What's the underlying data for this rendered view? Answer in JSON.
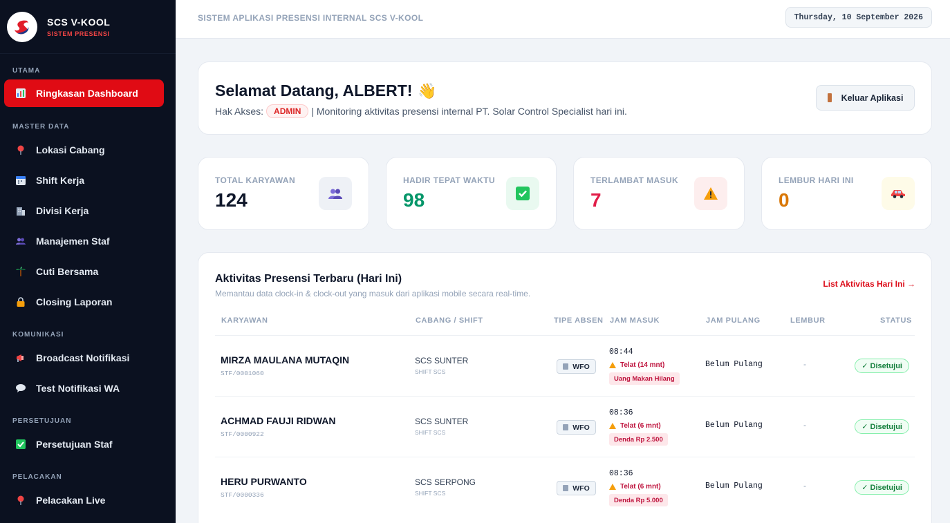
{
  "app": {
    "name": "SCS V-KOOL",
    "subtitle": "SISTEM PRESENSI"
  },
  "sidebar": {
    "sections": {
      "utama": "UTAMA",
      "master": "MASTER DATA",
      "komunikasi": "KOMUNIKASI",
      "persetujuan": "PERSETUJUAN",
      "pelacakan": "PELACAKAN"
    },
    "items": [
      {
        "label": "Ringkasan Dashboard",
        "icon": "chart-icon"
      },
      {
        "label": "Lokasi Cabang",
        "icon": "pin-icon"
      },
      {
        "label": "Shift Kerja",
        "icon": "calendar-icon"
      },
      {
        "label": "Divisi Kerja",
        "icon": "building-icon"
      },
      {
        "label": "Manajemen Staf",
        "icon": "users-icon"
      },
      {
        "label": "Cuti Bersama",
        "icon": "palm-icon"
      },
      {
        "label": "Closing Laporan",
        "icon": "lock-icon"
      },
      {
        "label": "Broadcast Notifikasi",
        "icon": "megaphone-icon"
      },
      {
        "label": "Test Notifikasi WA",
        "icon": "chat-icon"
      },
      {
        "label": "Persetujuan Staf",
        "icon": "check-icon"
      },
      {
        "label": "Pelacakan Live",
        "icon": "pin-icon"
      }
    ]
  },
  "header": {
    "title": "SISTEM APLIKASI PRESENSI INTERNAL SCS V-KOOL",
    "date": "Thursday, 10 September 2026"
  },
  "welcome": {
    "greeting": "Selamat Datang, ALBERT!",
    "wave": "👋",
    "access_label": "Hak Akses:",
    "role": "ADMIN",
    "description": "| Monitoring aktivitas presensi internal PT. Solar Control Specialist hari ini.",
    "logout": "Keluar Aplikasi"
  },
  "stats": [
    {
      "label": "TOTAL KARYAWAN",
      "value": "124",
      "color": "#0f172a",
      "icon": "users-icon",
      "icon_bg": "#eef1f6"
    },
    {
      "label": "HADIR TEPAT WAKTU",
      "value": "98",
      "color": "#059669",
      "icon": "check-icon",
      "icon_bg": "#e9f9f0"
    },
    {
      "label": "TERLAMBAT MASUK",
      "value": "7",
      "color": "#e11d48",
      "icon": "warning-icon",
      "icon_bg": "#fdeeee"
    },
    {
      "label": "LEMBUR HARI INI",
      "value": "0",
      "color": "#d97706",
      "icon": "car-icon",
      "icon_bg": "#fefbe8"
    }
  ],
  "activity": {
    "title": "Aktivitas Presensi Terbaru (Hari Ini)",
    "subtitle": "Memantau data clock-in & clock-out yang masuk dari aplikasi mobile secara real-time.",
    "link": "List Aktivitas Hari Ini →",
    "columns": [
      "KARYAWAN",
      "CABANG / SHIFT",
      "TIPE ABSEN",
      "JAM MASUK",
      "JAM PULANG",
      "LEMBUR",
      "STATUS"
    ],
    "rows": [
      {
        "name": "MIRZA MAULANA MUTAQIN",
        "id": "STF/0001060",
        "branch": "SCS SUNTER",
        "shift": "SHIFT SCS",
        "type": "WFO",
        "in": "08:44",
        "late": "Telat (14 mnt)",
        "penalty": "Uang Makan Hilang",
        "out": "Belum Pulang",
        "overtime": "-",
        "status": "✓ Disetujui"
      },
      {
        "name": "ACHMAD FAUJI RIDWAN",
        "id": "STF/0000922",
        "branch": "SCS SUNTER",
        "shift": "SHIFT SCS",
        "type": "WFO",
        "in": "08:36",
        "late": "Telat (6 mnt)",
        "penalty": "Denda Rp 2.500",
        "out": "Belum Pulang",
        "overtime": "-",
        "status": "✓ Disetujui"
      },
      {
        "name": "HERU PURWANTO",
        "id": "STF/0000336",
        "branch": "SCS SERPONG",
        "shift": "SHIFT SCS",
        "type": "WFO",
        "in": "08:36",
        "late": "Telat (6 mnt)",
        "penalty": "Denda Rp 5.000",
        "out": "Belum Pulang",
        "overtime": "-",
        "status": "✓ Disetujui"
      }
    ]
  }
}
